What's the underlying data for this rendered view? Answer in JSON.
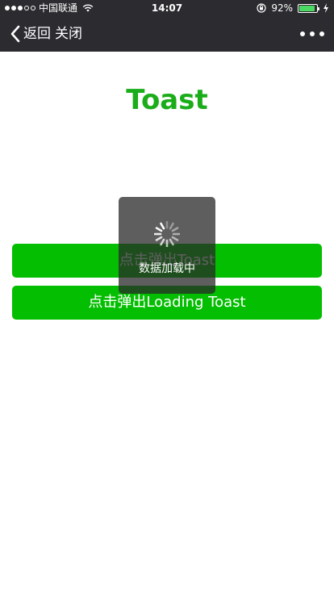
{
  "statusbar": {
    "carrier": "中国联通",
    "time": "14:07",
    "battery_percent": "92%",
    "battery_level": 0.92,
    "signal_bars_filled": 3,
    "signal_bars_total": 5
  },
  "nav": {
    "back_label": "返回",
    "close_label": "关闭",
    "more_icon": "more-horizontal-icon"
  },
  "page": {
    "title": "Toast",
    "title_color": "#1aad19",
    "button_color": "#04be02"
  },
  "buttons": {
    "toast": "点击弹出Toast",
    "loading_toast": "点击弹出Loading Toast"
  },
  "toast": {
    "message": "数据加载中",
    "icon": "loading-spinner-icon"
  }
}
